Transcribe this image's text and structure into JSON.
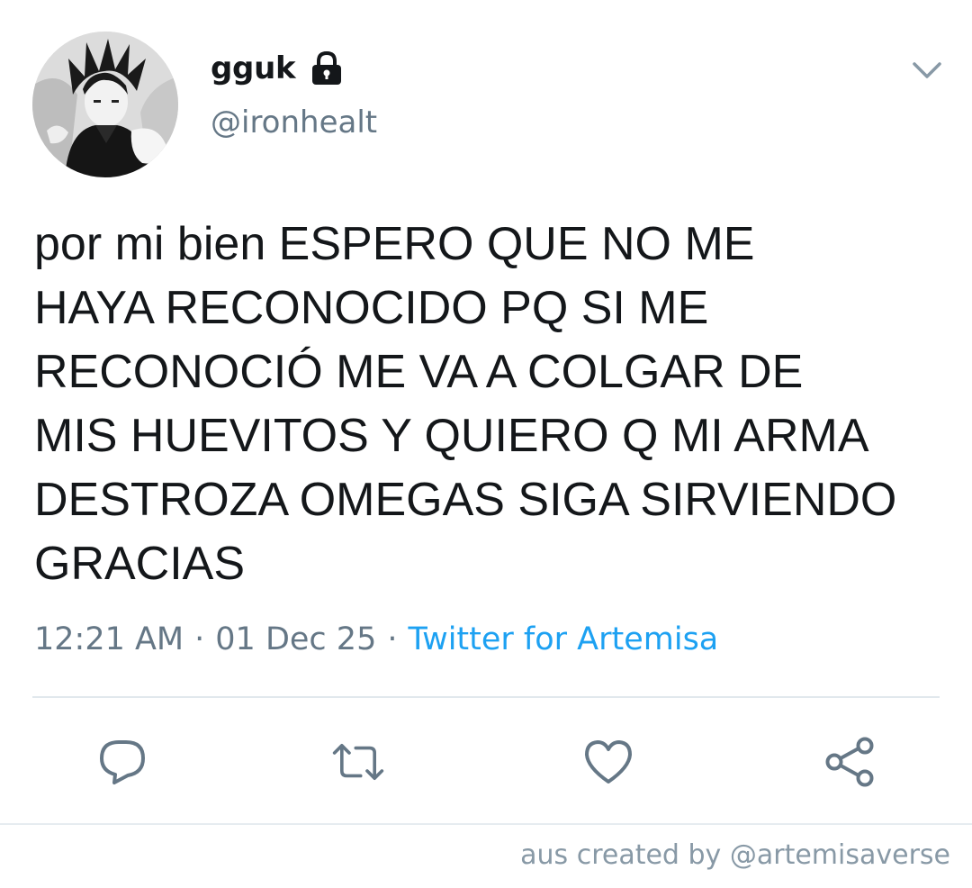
{
  "author": {
    "display_name": "gguk",
    "handle": "@ironhealt",
    "avatar": "anime-character-avatar",
    "protected_icon": "lock-icon"
  },
  "menu": {
    "icon": "chevron-down-icon"
  },
  "tweet": {
    "text": "por mi bien ESPERO QUE NO ME\nHAYA RECONOCIDO PQ SI ME\nRECONOCIÓ ME VA A COLGAR DE\nMIS HUEVITOS Y QUIERO Q MI ARMA\nDESTROZA OMEGAS SIGA SIRVIENDO\nGRACIAS",
    "time": "12:21 AM",
    "separator": "·",
    "date": "01 Dec 25",
    "source": "Twitter for Artemisa"
  },
  "actions": [
    {
      "name": "reply-button",
      "icon": "reply-icon"
    },
    {
      "name": "retweet-button",
      "icon": "retweet-icon"
    },
    {
      "name": "like-button",
      "icon": "heart-icon"
    },
    {
      "name": "share-button",
      "icon": "share-icon"
    }
  ],
  "footer": {
    "credit": "aus created by @artemisaverse"
  },
  "colors": {
    "text": "#14171a",
    "secondary": "#657786",
    "link": "#1da1f2",
    "divider": "#e1e8ed"
  }
}
